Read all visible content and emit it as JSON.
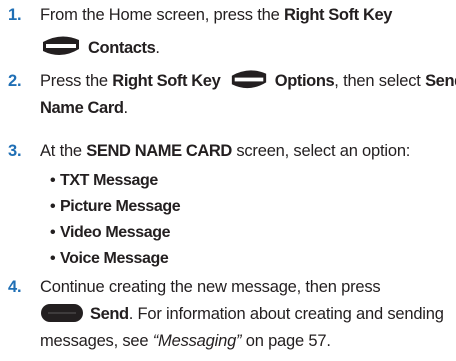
{
  "steps": [
    {
      "number": "1.",
      "text_a": "From the Home screen, press the ",
      "bold_a": "Right Soft Key",
      "bold_b": "Contacts",
      "text_b": "."
    },
    {
      "number": "2.",
      "text_a": "Press the ",
      "bold_a": "Right Soft Key",
      "bold_b": "Options",
      "text_b": ", then select ",
      "bold_c": "Send",
      "bold_d": "Name Card",
      "text_c": "."
    },
    {
      "number": "3.",
      "text_a": "At the ",
      "bold_a": "SEND NAME CARD",
      "text_b": " screen, select an option:",
      "options": [
        "TXT Message",
        "Picture Message",
        "Video Message",
        "Voice Message"
      ]
    },
    {
      "number": "4.",
      "line1": "Continue creating the new message, then press",
      "bold_a": "Send",
      "text_a": ". For information about creating and sending",
      "text_b": "messages, see ",
      "italic_a": "“Messaging”",
      "text_c": " on page 57."
    }
  ],
  "colors": {
    "step_number": "#1f6fb5",
    "body_text": "#231f20",
    "soft_key_icon": "#231f20"
  },
  "icons": {
    "right_soft_key": "right-soft-key-icon",
    "center_key": "center-select-key-icon"
  }
}
